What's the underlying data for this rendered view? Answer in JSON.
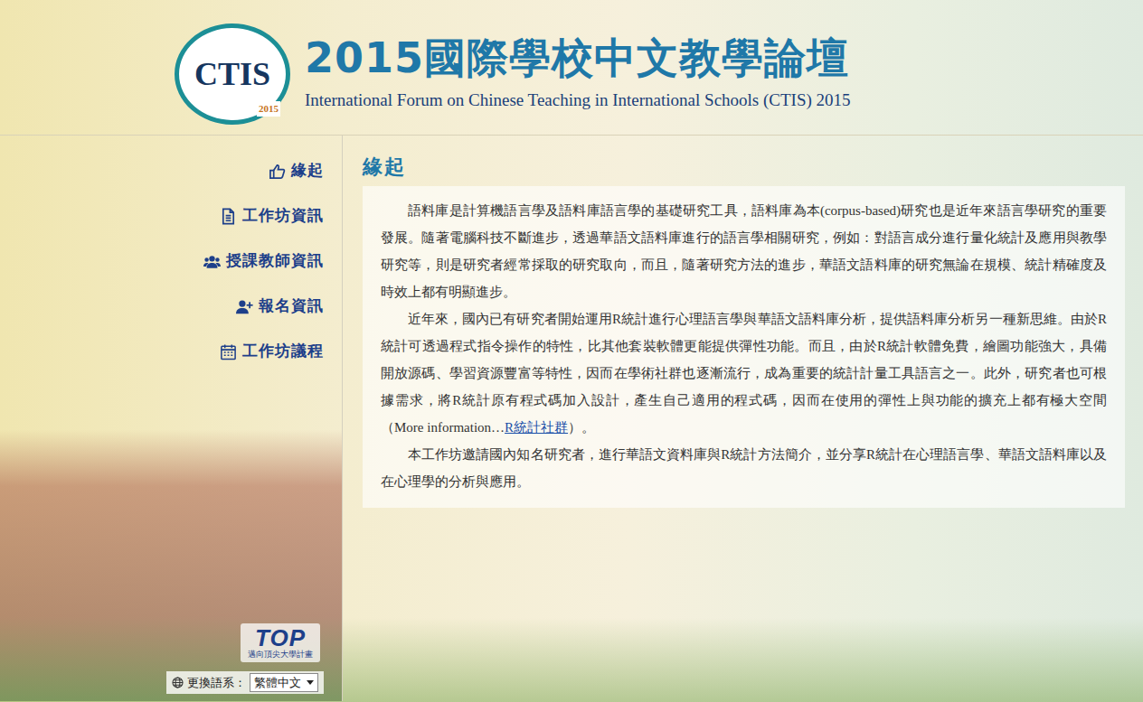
{
  "banner": {
    "logo": {
      "letters": "CTIS",
      "year": "2015"
    },
    "title": "2015國際學校中文教學論壇",
    "subtitle": "International Forum on Chinese Teaching in International Schools (CTIS) 2015"
  },
  "sidebar": {
    "items": [
      {
        "label": "緣起"
      },
      {
        "label": "工作坊資訊"
      },
      {
        "label": "授課教師資訊"
      },
      {
        "label": "報名資訊"
      },
      {
        "label": "工作坊議程"
      }
    ]
  },
  "sponsor_logo": {
    "text": "TOP",
    "caption": "邁向頂尖大學計畫"
  },
  "language": {
    "label": "更換語系：",
    "value": "繁體中文"
  },
  "content": {
    "heading": "緣起",
    "paragraphs": [
      [
        {
          "kind": "text",
          "text": "語料庫是計算機語言學及語料庫語言學的基礎研究工具，語料庫為本(corpus-based)研究也是近年來語言學研究的重要發展。隨著電腦科技不斷進步，透過華語文語料庫進行的語言學相關研究，例如：對語言成分進行量化統計及應用與教學研究等，則是研究者經常採取的研究取向，而且，隨著研究方法的進步，華語文語料庫的研究無論在規模、統計精確度及時效上都有明顯進步。"
        }
      ],
      [
        {
          "kind": "text",
          "text": "近年來，國內已有研究者開始運用R統計進行心理語言學與華語文語料庫分析，提供語料庫分析另一種新思維。由於R統計可透過程式指令操作的特性，比其他套裝軟體更能提供彈性功能。而且，由於R統計軟體免費，繪圖功能強大，具備開放源碼、學習資源豐富等特性，因而在學術社群也逐漸流行，成為重要的統計計量工具語言之一。此外，研究者也可根據需求，將R統計原有程式碼加入設計，產生自己適用的程式碼，因而在使用的彈性上與功能的擴充上都有極大空間（More information…"
        },
        {
          "kind": "link",
          "text": "R統計社群"
        },
        {
          "kind": "text",
          "text": "）。"
        }
      ],
      [
        {
          "kind": "text",
          "text": "本工作坊邀請國內知名研究者，進行華語文資料庫與R統計方法簡介，並分享R統計在心理語言學、華語文語料庫以及在心理學的分析與應用。"
        }
      ]
    ]
  }
}
